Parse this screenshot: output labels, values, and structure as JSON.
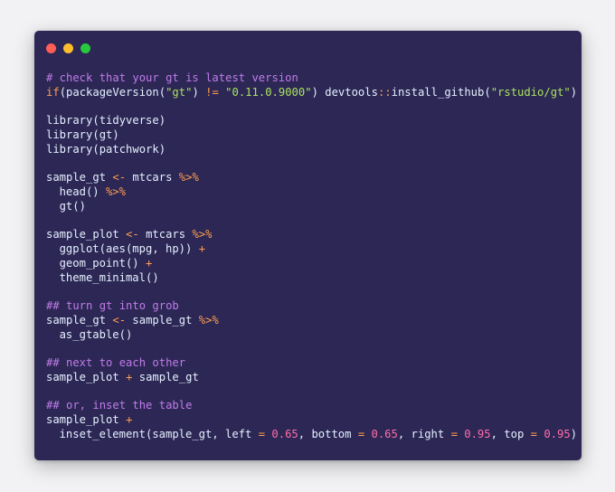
{
  "window": {
    "dots": [
      "close",
      "minimize",
      "maximize"
    ]
  },
  "code_lines": [
    [
      {
        "t": "comment",
        "v": "# check that your gt is latest version"
      }
    ],
    [
      {
        "t": "keyword",
        "v": "if"
      },
      {
        "t": "plain",
        "v": "(packageVersion("
      },
      {
        "t": "string",
        "v": "\"gt\""
      },
      {
        "t": "plain",
        "v": ") "
      },
      {
        "t": "op",
        "v": "!="
      },
      {
        "t": "plain",
        "v": " "
      },
      {
        "t": "string",
        "v": "\"0.11.0.9000\""
      },
      {
        "t": "plain",
        "v": ") devtools"
      },
      {
        "t": "ns",
        "v": "::"
      },
      {
        "t": "plain",
        "v": "install_github("
      },
      {
        "t": "string",
        "v": "\"rstudio/gt\""
      },
      {
        "t": "plain",
        "v": ")"
      }
    ],
    [],
    [
      {
        "t": "plain",
        "v": "library(tidyverse)"
      }
    ],
    [
      {
        "t": "plain",
        "v": "library(gt)"
      }
    ],
    [
      {
        "t": "plain",
        "v": "library(patchwork)"
      }
    ],
    [],
    [
      {
        "t": "plain",
        "v": "sample_gt "
      },
      {
        "t": "op",
        "v": "<-"
      },
      {
        "t": "plain",
        "v": " mtcars "
      },
      {
        "t": "op",
        "v": "%>%"
      }
    ],
    [
      {
        "t": "indent"
      },
      {
        "t": "plain",
        "v": "head() "
      },
      {
        "t": "op",
        "v": "%>%"
      }
    ],
    [
      {
        "t": "indent"
      },
      {
        "t": "plain",
        "v": "gt()"
      }
    ],
    [],
    [
      {
        "t": "plain",
        "v": "sample_plot "
      },
      {
        "t": "op",
        "v": "<-"
      },
      {
        "t": "plain",
        "v": " mtcars "
      },
      {
        "t": "op",
        "v": "%>%"
      }
    ],
    [
      {
        "t": "indent"
      },
      {
        "t": "plain",
        "v": "ggplot(aes(mpg, hp)) "
      },
      {
        "t": "op",
        "v": "+"
      }
    ],
    [
      {
        "t": "indent"
      },
      {
        "t": "plain",
        "v": "geom_point() "
      },
      {
        "t": "op",
        "v": "+"
      }
    ],
    [
      {
        "t": "indent"
      },
      {
        "t": "plain",
        "v": "theme_minimal()"
      }
    ],
    [],
    [
      {
        "t": "comment",
        "v": "## turn gt into grob"
      }
    ],
    [
      {
        "t": "plain",
        "v": "sample_gt "
      },
      {
        "t": "op",
        "v": "<-"
      },
      {
        "t": "plain",
        "v": " sample_gt "
      },
      {
        "t": "op",
        "v": "%>%"
      }
    ],
    [
      {
        "t": "indent"
      },
      {
        "t": "plain",
        "v": "as_gtable()"
      }
    ],
    [],
    [
      {
        "t": "comment",
        "v": "## next to each other"
      }
    ],
    [
      {
        "t": "plain",
        "v": "sample_plot "
      },
      {
        "t": "op",
        "v": "+"
      },
      {
        "t": "plain",
        "v": " sample_gt"
      }
    ],
    [],
    [
      {
        "t": "comment",
        "v": "## or, inset the table"
      }
    ],
    [
      {
        "t": "plain",
        "v": "sample_plot "
      },
      {
        "t": "op",
        "v": "+"
      }
    ],
    [
      {
        "t": "indent"
      },
      {
        "t": "plain",
        "v": "inset_element(sample_gt, left "
      },
      {
        "t": "op",
        "v": "="
      },
      {
        "t": "plain",
        "v": " "
      },
      {
        "t": "num",
        "v": "0.65"
      },
      {
        "t": "plain",
        "v": ", bottom "
      },
      {
        "t": "op",
        "v": "="
      },
      {
        "t": "plain",
        "v": " "
      },
      {
        "t": "num",
        "v": "0.65"
      },
      {
        "t": "plain",
        "v": ", right "
      },
      {
        "t": "op",
        "v": "="
      },
      {
        "t": "plain",
        "v": " "
      },
      {
        "t": "num",
        "v": "0.95"
      },
      {
        "t": "plain",
        "v": ", top "
      },
      {
        "t": "op",
        "v": "="
      },
      {
        "t": "plain",
        "v": " "
      },
      {
        "t": "num",
        "v": "0.95"
      },
      {
        "t": "plain",
        "v": ")"
      }
    ]
  ],
  "colors": {
    "background": "#f2f2f4",
    "window": "#2c2755",
    "comment": "#c07ce8",
    "keyword": "#ff9d4f",
    "string": "#a9e35c",
    "number": "#ff6ea8",
    "text": "#e6f0ff"
  }
}
